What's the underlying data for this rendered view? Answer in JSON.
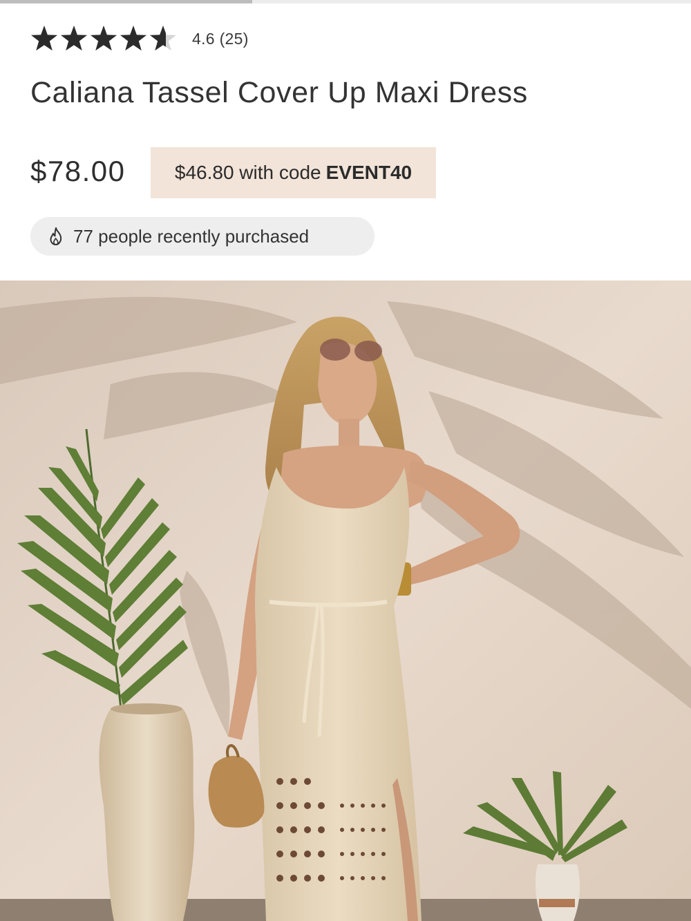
{
  "product": {
    "rating_text": "4.6 (25)",
    "rating_value": 4.6,
    "rating_max": 5,
    "title": "Caliana Tassel Cover Up Maxi Dress",
    "price": "$78.00",
    "promo_price": "$46.80 with code",
    "promo_code": "EVENT40",
    "recent_purchases": "77 people recently purchased"
  },
  "gallery": {
    "progress_fraction": 0.365
  },
  "icons": {
    "star": "star-icon",
    "flame": "flame-icon"
  },
  "colors": {
    "star": "#2b2b2b",
    "star_empty": "#d6d6d6",
    "promo_bg": "#f2e4d9",
    "pill_bg": "#eeeeee"
  }
}
